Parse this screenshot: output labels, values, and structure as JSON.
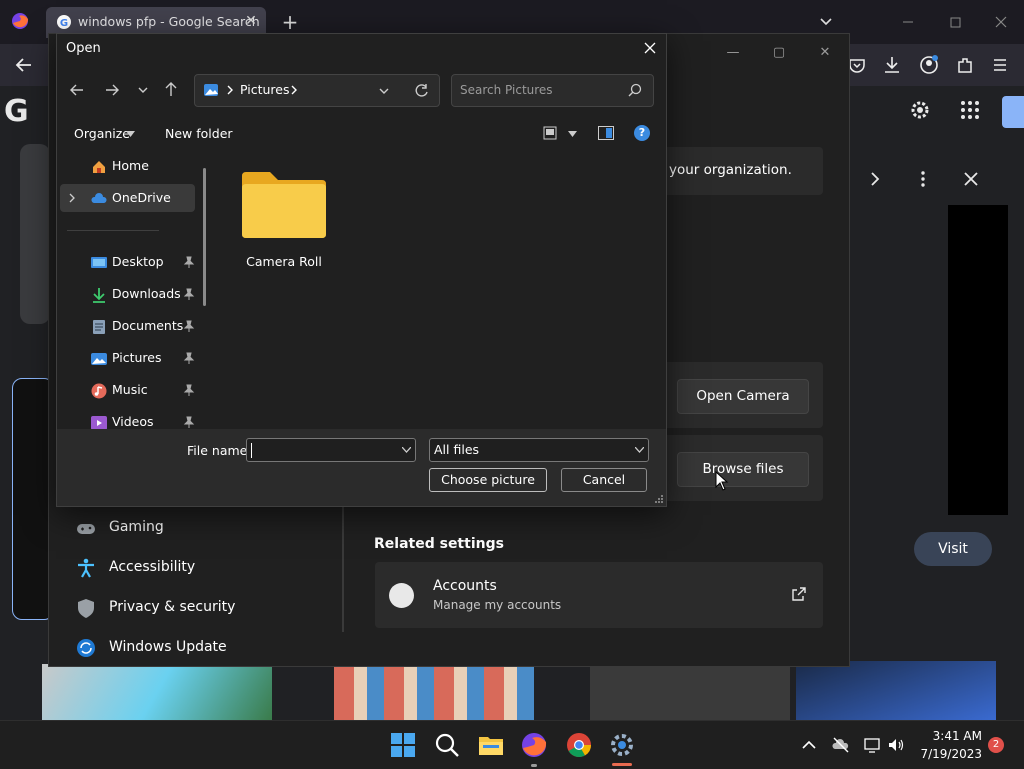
{
  "browser": {
    "tab_title": "windows pfp - Google Search",
    "tab_close": "✕",
    "new_tab": "+"
  },
  "settings": {
    "org_text": "your organization.",
    "open_camera": "Open Camera",
    "browse_files": "Browse files",
    "related_settings": "Related settings",
    "accounts_title": "Accounts",
    "accounts_sub": "Manage my accounts",
    "nav": [
      "Gaming",
      "Accessibility",
      "Privacy & security",
      "Windows Update"
    ]
  },
  "search_page": {
    "visit": "Visit"
  },
  "dialog": {
    "title": "Open",
    "address_folder": "Pictures",
    "search_placeholder": "Search Pictures",
    "organize": "Organize",
    "new_folder": "New folder",
    "help": "?",
    "pane": [
      {
        "label": "Home",
        "icon": "home-icon",
        "pinned": false
      },
      {
        "label": "OneDrive",
        "icon": "cloud-icon",
        "pinned": false
      },
      {
        "label": "Desktop",
        "icon": "desktop-icon",
        "pinned": true
      },
      {
        "label": "Downloads",
        "icon": "download-icon",
        "pinned": true
      },
      {
        "label": "Documents",
        "icon": "document-icon",
        "pinned": true
      },
      {
        "label": "Pictures",
        "icon": "pictures-icon",
        "pinned": true
      },
      {
        "label": "Music",
        "icon": "music-icon",
        "pinned": true
      },
      {
        "label": "Videos",
        "icon": "video-icon",
        "pinned": true
      }
    ],
    "folder": "Camera Roll",
    "file_name_label": "File name:",
    "file_name_value": "",
    "file_type": "All files",
    "choose": "Choose picture",
    "cancel": "Cancel"
  },
  "taskbar": {
    "time": "3:41 AM",
    "date": "7/19/2023",
    "notifications": "2"
  },
  "colors": {
    "accent": "#3b8be0",
    "folder": "#f4c542",
    "notification": "#e0504a"
  }
}
